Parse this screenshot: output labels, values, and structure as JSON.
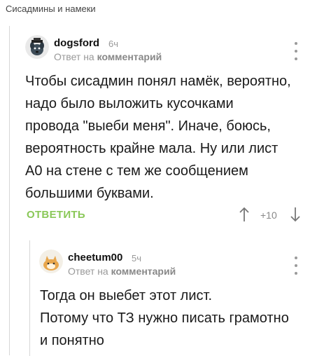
{
  "post": {
    "title": "Сисадмины и намеки"
  },
  "comment1": {
    "username": "dogsford",
    "time": "6ч",
    "reply_prefix": "Ответ на",
    "reply_target": "комментарий",
    "text": "Чтобы сисадмин понял намёк, вероятно,\nнадо было выложить кусочками\nпровода \"выеби меня\". Иначе, боюсь,\nвероятность крайне мала. Ну или лист\nА0 на стене с тем же сообщением\nбольшими буквами.",
    "reply_label": "ОТВЕТИТЬ",
    "rating": "+10",
    "icons": {
      "avatar": "dog-avatar",
      "menu": "more-vertical-icon",
      "upvote": "arrow-up-icon",
      "downvote": "arrow-down-icon"
    }
  },
  "comment2": {
    "username": "cheetum00",
    "time": "5ч",
    "reply_prefix": "Ответ на",
    "reply_target": "комментарий",
    "text": "Тогда он выебет этот лист.\nПотому что ТЗ нужно писать грамотно\nи понятно",
    "icons": {
      "avatar": "cat-avatar",
      "menu": "more-vertical-icon"
    }
  },
  "colors": {
    "accent_green": "#8ac858",
    "muted": "#999999",
    "thread_line": "#d6d6d6"
  }
}
